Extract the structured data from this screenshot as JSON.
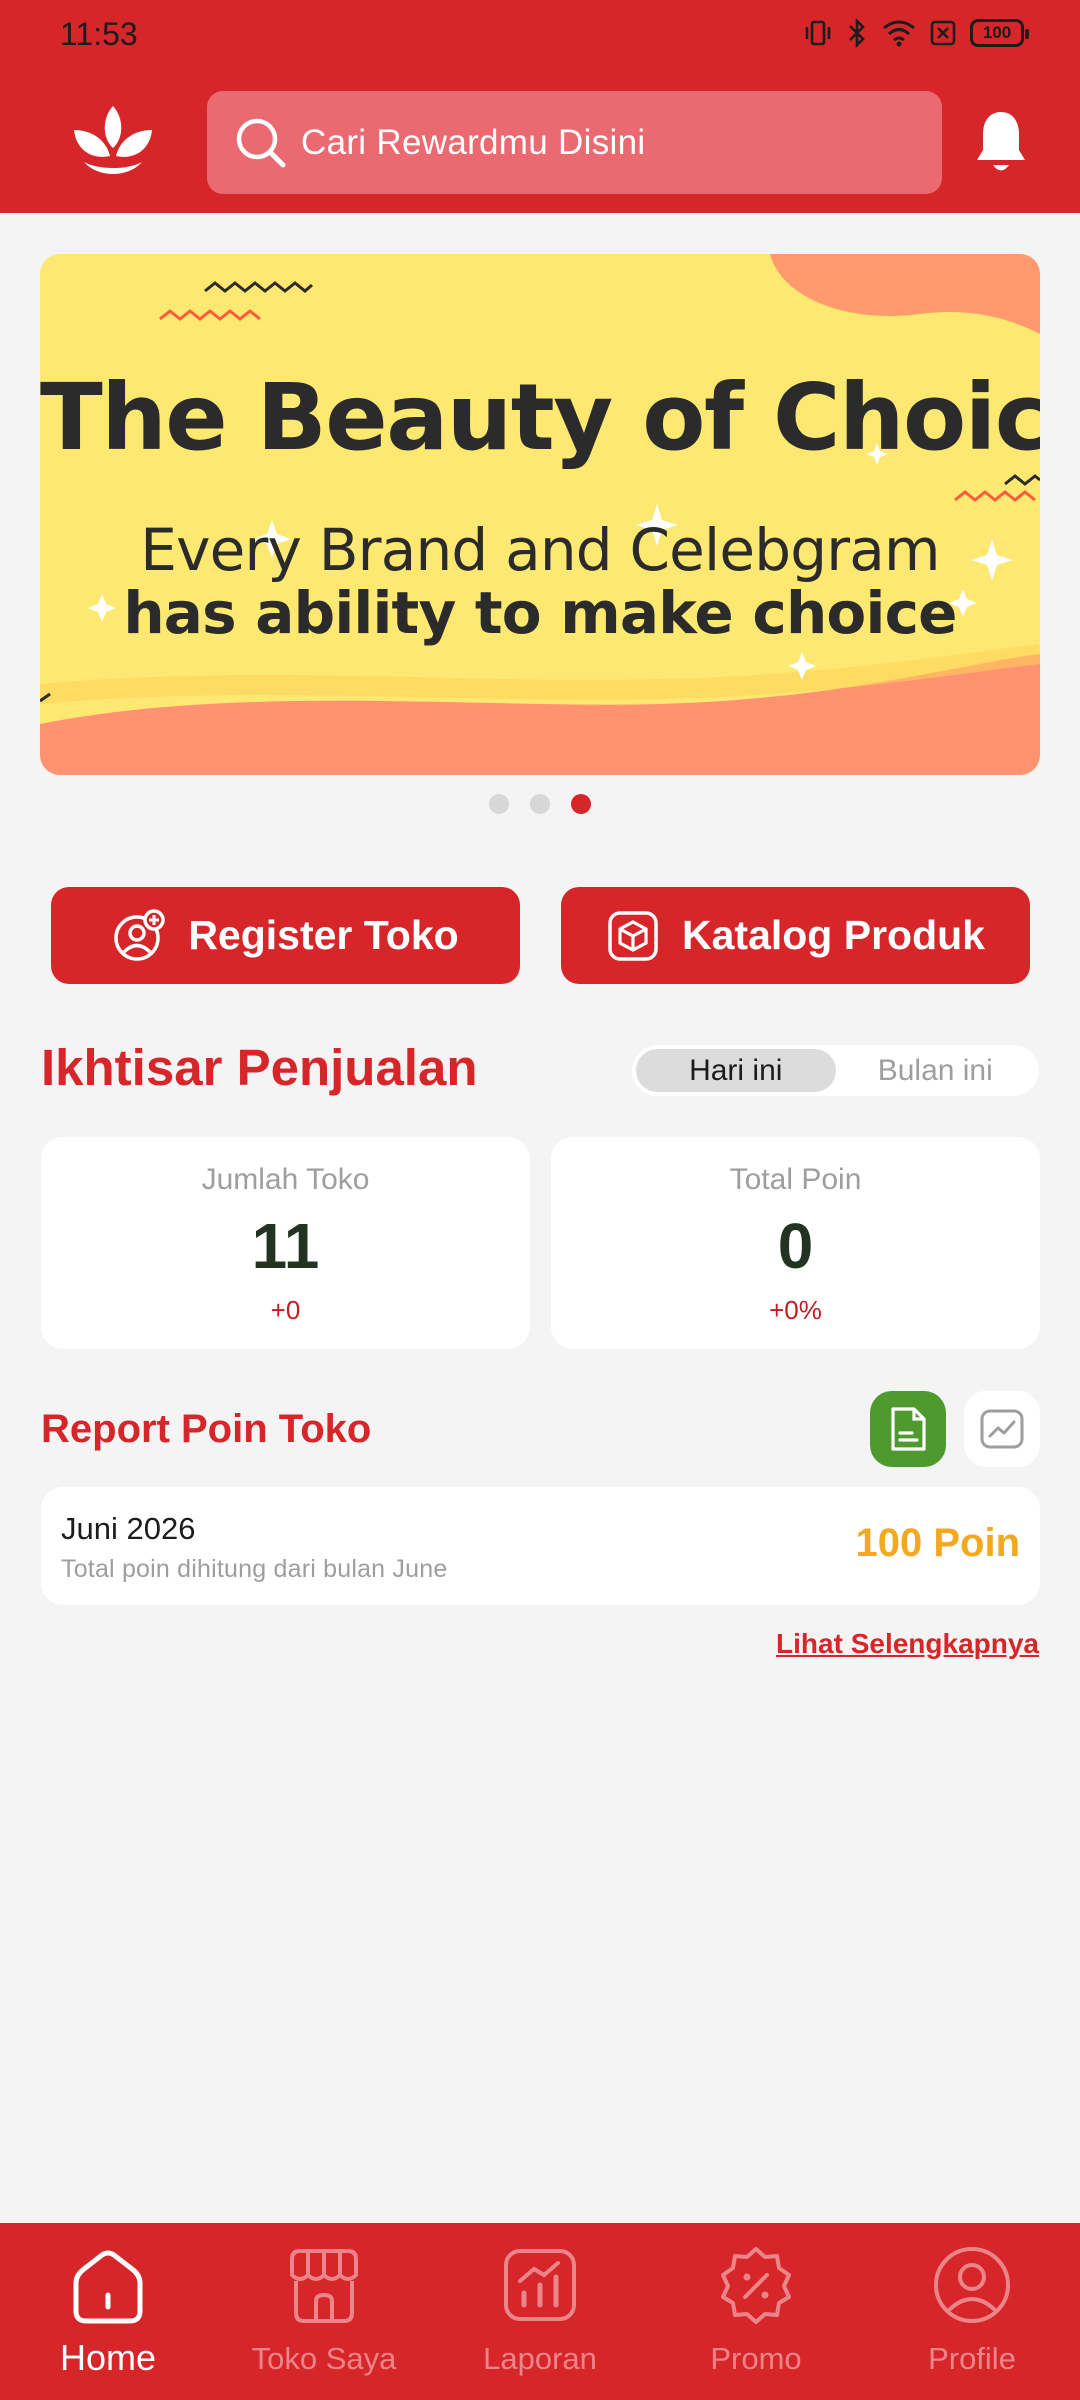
{
  "status_bar": {
    "time": "11:53",
    "battery": "100"
  },
  "header": {
    "search_placeholder": "Cari Rewardmu Disini",
    "brand_color": "#d7262a"
  },
  "banner": {
    "title": "The Beauty of Choice",
    "line1": "Every Brand and Celebgram",
    "line2": "has ability to make choice",
    "slide_count": 3,
    "active_slide": 3
  },
  "actions": {
    "register_label": "Register Toko",
    "katalog_label": "Katalog Produk"
  },
  "ikhtisar": {
    "title": "Ikhtisar Penjualan",
    "toggle": {
      "today": "Hari ini",
      "month": "Bulan ini",
      "selected": "Hari ini"
    },
    "cards": [
      {
        "label": "Jumlah Toko",
        "value": "11",
        "delta": "+0"
      },
      {
        "label": "Total Poin",
        "value": "0",
        "delta": "+0%"
      }
    ]
  },
  "report": {
    "title": "Report Poin Toko",
    "item": {
      "month": "Juni 2026",
      "description": "Total poin dihitung dari bulan June",
      "points": "100 Poin"
    },
    "see_more": "Lihat Selengkapnya"
  },
  "nav": {
    "items": [
      {
        "label": "Home",
        "icon": "home-icon",
        "active": true
      },
      {
        "label": "Toko Saya",
        "icon": "store-icon",
        "active": false
      },
      {
        "label": "Laporan",
        "icon": "report-chart-icon",
        "active": false
      },
      {
        "label": "Promo",
        "icon": "promo-badge-icon",
        "active": false
      },
      {
        "label": "Profile",
        "icon": "profile-icon",
        "active": false
      }
    ]
  }
}
